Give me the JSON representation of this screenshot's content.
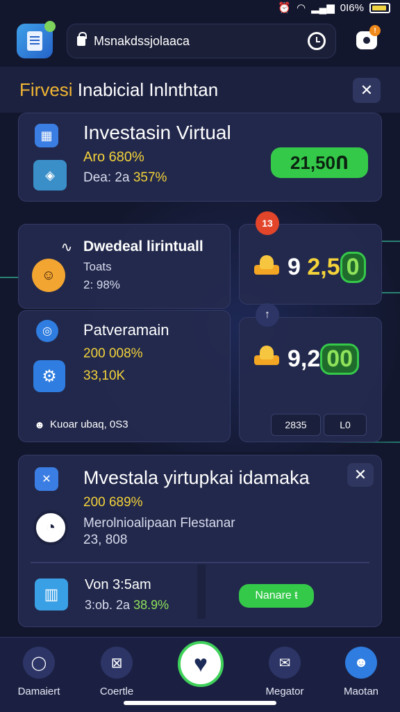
{
  "status_bar": {
    "battery_text": "0I6%"
  },
  "top_bar": {
    "url": "Msnakdssjolaaca"
  },
  "header": {
    "title_accent": "Firvesi",
    "title_rest": "Inabicial Inlnthtan"
  },
  "card_main": {
    "title": "Investasin Virtual",
    "line1": "Aro 680%",
    "line2_label": "Dea: 2a",
    "line2_value": "357%",
    "pill_value": "21,50Ո"
  },
  "card_left_top": {
    "title": "Dwedeal lirintuall",
    "subtitle": "Toats",
    "value": "2: 98%"
  },
  "card_right_top": {
    "badge": "13",
    "value_white": "9",
    "value_yellow": "2,5",
    "value_box": "0"
  },
  "card_left_bottom": {
    "title": "Patveramain",
    "line1": "200 008%",
    "line2": "33,10K",
    "footer": "Kuoar ubaq, 0S3"
  },
  "card_right_bottom": {
    "value_white": "9,2",
    "value_box": "00",
    "box1": "2835",
    "box2": "L0"
  },
  "card_portfolio": {
    "title": "Mvestala yirtupkai idamaka",
    "line1": "200 689%",
    "line2": "Merolnioalipaan Flestanar",
    "line3": "23, 808",
    "sub_title": "Von 3:5am",
    "sub_label": "3:ob. 2a",
    "sub_value": "38.9%",
    "button": "Nanare ŧ"
  },
  "nav": {
    "items": [
      {
        "label": "Damaiert"
      },
      {
        "label": "Coertle"
      },
      {
        "label": "Megator"
      },
      {
        "label": "Maotan"
      }
    ]
  },
  "colors": {
    "background": "#13172e",
    "card": "#242a4e",
    "accent_yellow": "#f4d33a",
    "accent_green": "#35c94a",
    "accent_orange": "#f2b632"
  }
}
